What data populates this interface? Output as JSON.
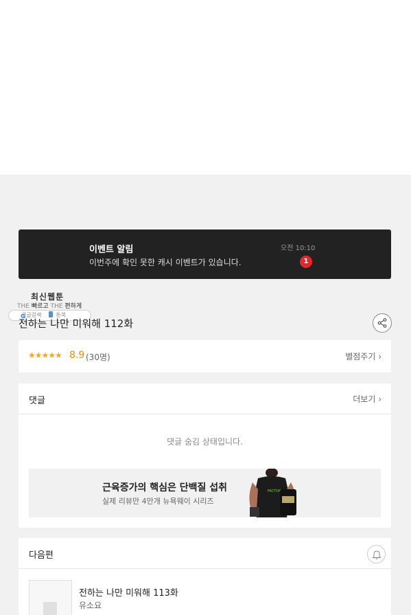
{
  "notice": {
    "title": "이벤트 알림",
    "message": "이번주에 확인 못한 캐시 이벤트가 있습니다.",
    "time": "오전 10:10",
    "badge": "1"
  },
  "logo": {
    "main": "최신웹툰",
    "sub_prefix": "THE",
    "sub_fast": "빠르고",
    "sub_mid": "THE",
    "sub_easy": "편하게",
    "google_label": "구글검색",
    "bookmark_label": "툰북"
  },
  "episode": {
    "title": "전하는 나만 미워해 112화"
  },
  "rating": {
    "stars": "★★★★★",
    "score": "8.9",
    "count": "(30명)",
    "rate_link": "별점주기 ›"
  },
  "comments": {
    "title": "댓글",
    "more_link": "더보기 ›",
    "hidden_message": "댓글 숨김 상태입니다."
  },
  "ad": {
    "title": "근육증가의 핵심은 단백질 섭취",
    "subtitle": "실제 리뷰만 4만개 뉴욕웨이 시리즈"
  },
  "next": {
    "section_title": "다음편",
    "episode_title": "전하는 나만 미워해 113화",
    "author": "유소요"
  },
  "colors": {
    "notice_bg": "#222222",
    "badge": "#e0282d",
    "star": "#f5a623",
    "score": "#f08c00",
    "page_bg": "#f1f1f1"
  },
  "icons": [
    "share-icon",
    "bell-icon",
    "google-icon",
    "bookmark-icon",
    "chevron-right-icon"
  ]
}
